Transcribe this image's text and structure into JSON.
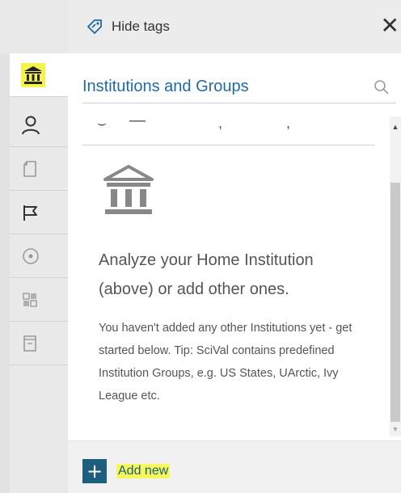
{
  "header": {
    "hide_tags_label": "Hide tags",
    "close_symbol": "✕"
  },
  "sidebar": {
    "items": [
      {
        "icon": "institution-icon",
        "active": true
      },
      {
        "icon": "person-icon",
        "active": false
      },
      {
        "icon": "document-icon",
        "active": false
      },
      {
        "icon": "flag-icon",
        "active": false
      },
      {
        "icon": "target-icon",
        "active": false
      },
      {
        "icon": "grid-icon",
        "active": false
      },
      {
        "icon": "book-icon",
        "active": false
      }
    ]
  },
  "panel": {
    "title": "Institutions and Groups",
    "empty_state": {
      "heading": "Analyze your Home Institution (above) or add other ones.",
      "body": "You haven't added any other Institutions yet - get started below. Tip: SciVal contains predefined Institution Groups, e.g. US States, UArctic, Ivy League etc."
    }
  },
  "footer": {
    "add_label": "Add new",
    "plus_symbol": "+"
  },
  "colors": {
    "accent": "#1f6aa5",
    "button": "#1d5e7f",
    "highlight": "#f5f75a",
    "rail": "#e9e9e9"
  }
}
